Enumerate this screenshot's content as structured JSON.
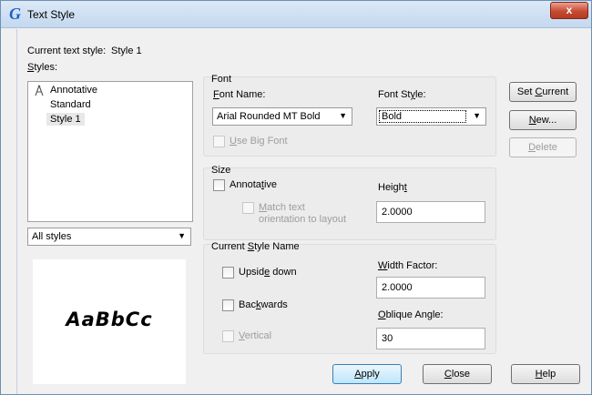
{
  "window": {
    "title": "Text Style",
    "close_glyph": "x"
  },
  "current_style": {
    "label": "Current text style:",
    "value": "Style 1"
  },
  "styles": {
    "label": "Styles:",
    "items": [
      {
        "label": "Annotative",
        "icon": "annotative-icon"
      },
      {
        "label": "Standard"
      },
      {
        "label": "Style 1",
        "selected": true
      }
    ],
    "filter": "All styles"
  },
  "preview": {
    "text": "AaBbCc"
  },
  "font": {
    "group_label": "Font",
    "name_label": "Font Name:",
    "name_value": "Arial Rounded MT Bold",
    "style_label": "Font Style:",
    "style_value": "Bold",
    "big_font_label": "Use Big Font"
  },
  "size": {
    "group_label": "Size",
    "annotative_label": "Annotative",
    "match_line1": "Match text",
    "match_line2": "orientation to layout",
    "height_label": "Height",
    "height_value": "2.0000"
  },
  "effects": {
    "group_label": "Current Style Name",
    "upside_down_label": "Upside down",
    "backwards_label": "Backwards",
    "vertical_label": "Vertical",
    "width_factor_label": "Width Factor:",
    "width_factor_value": "2.0000",
    "oblique_label": "Oblique Angle:",
    "oblique_value": "30"
  },
  "buttons": {
    "set_current": "Set Current",
    "new": "New...",
    "delete": "Delete",
    "apply": "Apply",
    "close": "Close",
    "help": "Help"
  },
  "colors": {
    "accent": "#1d62c8",
    "close": "#c64b32"
  }
}
